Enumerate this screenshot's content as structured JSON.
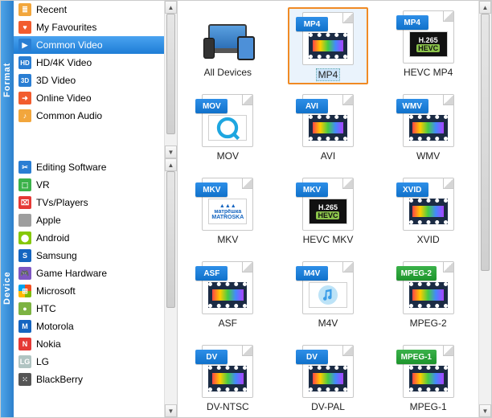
{
  "tabs": {
    "format": "Format",
    "device": "Device"
  },
  "format_items": [
    {
      "label": "Recent",
      "icon": "list-icon",
      "bg": "#f2a63c"
    },
    {
      "label": "My Favourites",
      "icon": "heart-icon",
      "bg": "#f25c2e"
    },
    {
      "label": "Common Video",
      "icon": "video-icon",
      "bg": "#2a7ed3",
      "selected": true
    },
    {
      "label": "HD/4K Video",
      "icon": "hd-icon",
      "bg": "#2a7ed3",
      "text": "HD"
    },
    {
      "label": "3D Video",
      "icon": "3d-icon",
      "bg": "#2a7ed3",
      "text": "3D"
    },
    {
      "label": "Online Video",
      "icon": "online-icon",
      "bg": "#f25c2e"
    },
    {
      "label": "Common Audio",
      "icon": "audio-icon",
      "bg": "#f2a63c"
    }
  ],
  "device_items": [
    {
      "label": "Editing Software",
      "icon": "editing-icon",
      "bg": "#2a7ed3"
    },
    {
      "label": "VR",
      "icon": "vr-icon",
      "bg": "#3bb24a"
    },
    {
      "label": "TVs/Players",
      "icon": "tv-icon",
      "bg": "#e53935"
    },
    {
      "label": "Apple",
      "icon": "apple-icon",
      "bg": "#9e9e9e"
    },
    {
      "label": "Android",
      "icon": "android-icon",
      "bg": "#85c808"
    },
    {
      "label": "Samsung",
      "icon": "samsung-icon",
      "bg": "#1565c0"
    },
    {
      "label": "Game Hardware",
      "icon": "game-icon",
      "bg": "#7e57c2"
    },
    {
      "label": "Microsoft",
      "icon": "microsoft-icon",
      "bg": "#ffffff"
    },
    {
      "label": "HTC",
      "icon": "htc-icon",
      "bg": "#7cb342"
    },
    {
      "label": "Motorola",
      "icon": "motorola-icon",
      "bg": "#1565c0"
    },
    {
      "label": "Nokia",
      "icon": "nokia-icon",
      "bg": "#e53935"
    },
    {
      "label": "LG",
      "icon": "lg-icon",
      "bg": "#b0c4c2"
    },
    {
      "label": "BlackBerry",
      "icon": "blackberry-icon",
      "bg": "#555"
    }
  ],
  "grid": [
    {
      "label": "All Devices",
      "type": "devices"
    },
    {
      "label": "MP4",
      "badge": "MP4",
      "badgeColor": "#2e8fe8",
      "inner": "film-color",
      "selected": true
    },
    {
      "label": "HEVC MP4",
      "badge": "MP4",
      "badgeColor": "#2e8fe8",
      "inner": "h265"
    },
    {
      "label": "MOV",
      "badge": "MOV",
      "badgeColor": "#2e8fe8",
      "inner": "qt"
    },
    {
      "label": "AVI",
      "badge": "AVI",
      "badgeColor": "#2e8fe8",
      "inner": "film-color"
    },
    {
      "label": "WMV",
      "badge": "WMV",
      "badgeColor": "#2e8fe8",
      "inner": "film-color"
    },
    {
      "label": "MKV",
      "badge": "MKV",
      "badgeColor": "#2e8fe8",
      "inner": "matroska"
    },
    {
      "label": "HEVC MKV",
      "badge": "MKV",
      "badgeColor": "#2e8fe8",
      "inner": "h265"
    },
    {
      "label": "XVID",
      "badge": "XVID",
      "badgeColor": "#2e8fe8",
      "inner": "film-color"
    },
    {
      "label": "ASF",
      "badge": "ASF",
      "badgeColor": "#2e8fe8",
      "inner": "film-color"
    },
    {
      "label": "M4V",
      "badge": "M4V",
      "badgeColor": "#2e8fe8",
      "inner": "itunes"
    },
    {
      "label": "MPEG-2",
      "badge": "MPEG-2",
      "badgeColor": "#3bb24a",
      "inner": "film-color"
    },
    {
      "label": "DV-NTSC",
      "badge": "DV",
      "badgeColor": "#2e8fe8",
      "inner": "film-color"
    },
    {
      "label": "DV-PAL",
      "badge": "DV",
      "badgeColor": "#2e8fe8",
      "inner": "film-color"
    },
    {
      "label": "MPEG-1",
      "badge": "MPEG-1",
      "badgeColor": "#3bb24a",
      "inner": "film-color"
    }
  ]
}
